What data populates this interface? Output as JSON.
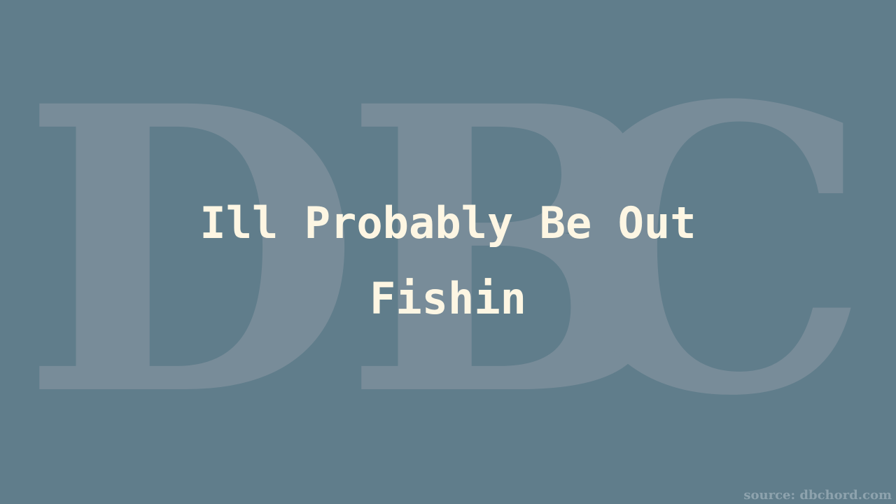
{
  "watermark": {
    "letters": [
      "D",
      "B",
      "C"
    ]
  },
  "title": {
    "line1": "Ill Probably Be Out",
    "line2": "Fishin"
  },
  "source": "source: dbchord.com",
  "colors": {
    "background": "#607d8b",
    "watermark": "#788c99",
    "title": "#fdf6e3"
  }
}
